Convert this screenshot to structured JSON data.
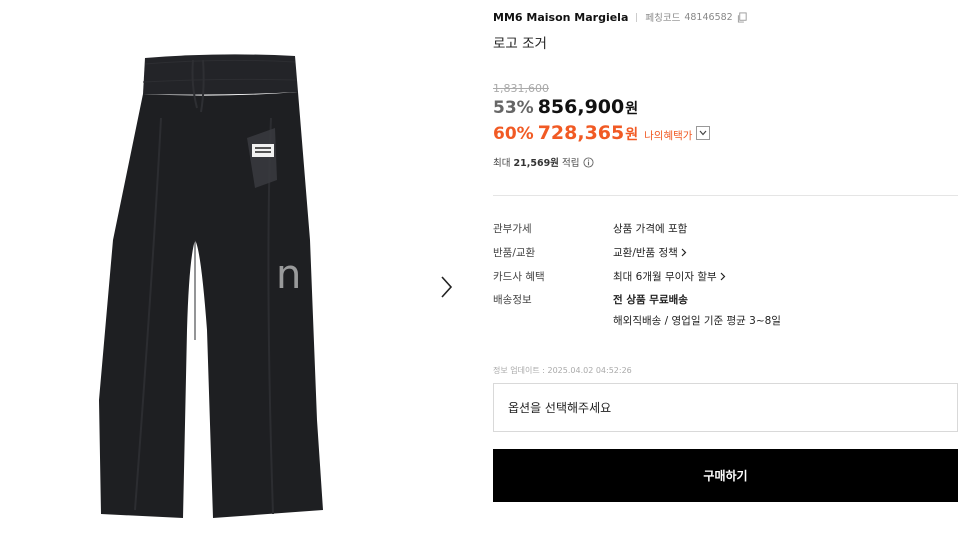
{
  "product": {
    "brand": "MM6 Maison Margiela",
    "code_label": "페칭코드",
    "code": "48146582",
    "title": "로고 조거",
    "watermark": "n"
  },
  "pricing": {
    "original": "1,831,600",
    "discount_pct": "53%",
    "price": "856,900",
    "won": "원",
    "benefit_pct": "60%",
    "benefit_price": "728,365",
    "my_benefit_label": "나의혜택가",
    "points_prefix": "최대",
    "points_amount": "21,569원",
    "points_suffix": "적립"
  },
  "details": [
    {
      "label": "관부가세",
      "value": "상품 가격에 포함"
    },
    {
      "label": "반품/교환",
      "value": "교환/반품 정책"
    },
    {
      "label": "카드사 혜택",
      "value": "최대 6개월 무이자 할부"
    },
    {
      "label": "배송정보",
      "value": "전 상품 무료배송",
      "sub": "해외직배송 / 영업일 기준 평균 3~8일"
    }
  ],
  "updated": "정보 업데이트 : 2025.04.02 04:52:26",
  "option_placeholder": "옵션을 선택해주세요",
  "buy_label": "구매하기",
  "colors": {
    "accent": "#f15a24",
    "buy_bg": "#000000",
    "product": "#1e1f22"
  }
}
